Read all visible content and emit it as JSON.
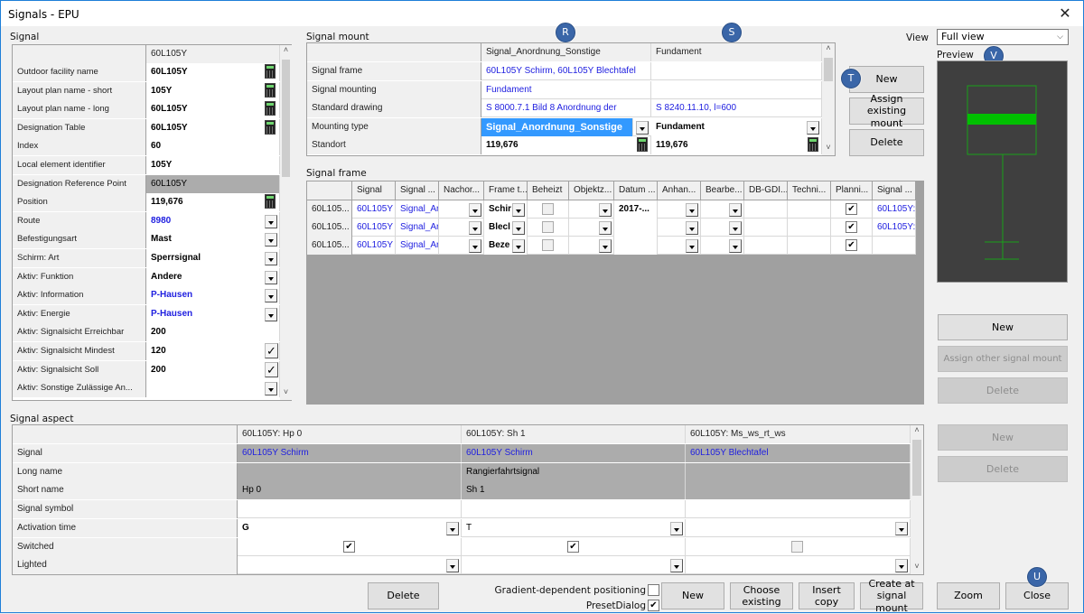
{
  "window": {
    "title": "Signals - EPU",
    "close_icon": "close-icon"
  },
  "signal": {
    "group_label": "Signal",
    "column_header": "60L105Y",
    "rows": [
      {
        "label": "Outdoor facility name",
        "value": "60L105Y",
        "control": "calc"
      },
      {
        "label": "Layout plan name - short",
        "value": "105Y",
        "control": "calc"
      },
      {
        "label": "Layout plan name - long",
        "value": "60L105Y",
        "control": "calc"
      },
      {
        "label": "Designation Table",
        "value": "60L105Y",
        "control": "calc"
      },
      {
        "label": "Index",
        "value": "60",
        "control": ""
      },
      {
        "label": "Local element identifier",
        "value": "105Y",
        "control": ""
      },
      {
        "label": "Designation Reference Point",
        "value": "60L105Y",
        "control": "readonly"
      },
      {
        "label": "Position",
        "value": "119,676",
        "control": "calc"
      },
      {
        "label": "Route",
        "value": "8980",
        "control": "dropdown",
        "color": "blue"
      },
      {
        "label": "Befestigungsart",
        "value": "Mast",
        "control": "dropdown"
      },
      {
        "label": "Schirm: Art",
        "value": "Sperrsignal",
        "control": "dropdown"
      },
      {
        "label": "Aktiv: Funktion",
        "value": "Andere",
        "control": "dropdown"
      },
      {
        "label": "Aktiv: Information",
        "value": "P-Hausen",
        "control": "dropdown",
        "color": "blue"
      },
      {
        "label": "Aktiv: Energie",
        "value": "P-Hausen",
        "control": "dropdown",
        "color": "blue"
      },
      {
        "label": "Aktiv: Signalsicht Erreichbar",
        "value": "200",
        "control": ""
      },
      {
        "label": "Aktiv: Signalsicht Mindest",
        "value": "120",
        "control": "check"
      },
      {
        "label": "Aktiv: Signalsicht Soll",
        "value": "200",
        "control": "check"
      },
      {
        "label": "Aktiv: Sonstige Zulässige An...",
        "value": "",
        "control": "dropdown"
      }
    ]
  },
  "signal_mount": {
    "group_label": "Signal mount",
    "columns": [
      "Signal_Anordnung_Sonstige",
      "Fundament"
    ],
    "rows": [
      {
        "label": "Signal frame",
        "values": [
          "60L105Y Schirm, 60L105Y Blechtafel",
          ""
        ]
      },
      {
        "label": "Signal mounting",
        "values": [
          "Fundament",
          ""
        ]
      },
      {
        "label": "Standard drawing",
        "values": [
          "S 8000.7.1 Bild 8 Anordnung der",
          "S 8240.11.10, l=600"
        ]
      },
      {
        "label": "Mounting type",
        "values": [
          "Signal_Anordnung_Sonstige",
          "Fundament"
        ]
      },
      {
        "label": "Standort",
        "values": [
          "119,676",
          "119,676"
        ]
      }
    ],
    "buttons": {
      "new": "New",
      "assign_existing": "Assign existing mount",
      "delete": "Delete"
    }
  },
  "signal_frame": {
    "group_label": "Signal frame",
    "columns": [
      "",
      "Signal",
      "Signal ...",
      "Nachor...",
      "Frame t...",
      "Beheizt",
      "Objektz...",
      "Datum ...",
      "Anhan...",
      "Bearbe...",
      "DB-GDI...",
      "Techni...",
      "Planni...",
      "Signal ..."
    ],
    "rows": [
      {
        "id": "60L105...",
        "signal": "60L105Y",
        "signal2": "Signal_Ar",
        "frame_type": "Schir",
        "datum": "2017-...",
        "planning": true,
        "signal_last": "60L105Y:"
      },
      {
        "id": "60L105...",
        "signal": "60L105Y",
        "signal2": "Signal_Ar",
        "frame_type": "Blecl",
        "datum": "",
        "planning": true,
        "signal_last": "60L105Y:"
      },
      {
        "id": "60L105...",
        "signal": "60L105Y",
        "signal2": "Signal_Ar",
        "frame_type": "Beze",
        "datum": "",
        "planning": true,
        "signal_last": ""
      }
    ]
  },
  "view": {
    "label": "View",
    "selected": "Full view"
  },
  "preview": {
    "label": "Preview"
  },
  "right_buttons": {
    "frame_new": "New",
    "assign_other": "Assign other signal mount",
    "frame_delete": "Delete",
    "aspect_new": "New",
    "aspect_delete": "Delete"
  },
  "signal_aspect": {
    "group_label": "Signal aspect",
    "columns": [
      "60L105Y: Hp 0",
      "60L105Y: Sh 1",
      "60L105Y: Ms_ws_rt_ws"
    ],
    "rows": [
      {
        "label": "Signal",
        "values": [
          "60L105Y Schirm",
          "60L105Y Schirm",
          "60L105Y Blechtafel"
        ]
      },
      {
        "label": "Long name",
        "values": [
          "",
          "Rangierfahrtsignal",
          ""
        ]
      },
      {
        "label": "Short name",
        "values": [
          "Hp 0",
          "Sh 1",
          ""
        ]
      },
      {
        "label": "Signal symbol",
        "values": [
          "",
          "",
          ""
        ]
      },
      {
        "label": "Activation time",
        "values": [
          "G",
          "T",
          ""
        ]
      },
      {
        "label": "Switched",
        "values": [
          true,
          true,
          false
        ]
      },
      {
        "label": "Lighted",
        "values": [
          "",
          "",
          ""
        ]
      }
    ]
  },
  "bottom": {
    "delete": "Delete",
    "gradient_label": "Gradient-dependent positioning",
    "gradient_checked": false,
    "preset_label": "PresetDialog",
    "preset_checked": true,
    "new": "New",
    "choose_existing": "Choose existing",
    "insert_copy": "Insert copy",
    "create_at_mount": "Create at signal mount",
    "zoom": "Zoom",
    "close": "Close"
  },
  "badges": {
    "r": "R",
    "s": "S",
    "t": "T",
    "u": "U",
    "v": "V"
  },
  "colors": {
    "accent_blue": "#2020e0",
    "selection": "#3399ff",
    "preview_bg": "#3f3f3f",
    "preview_green": "#00c000",
    "badge": "#3a66a8"
  }
}
